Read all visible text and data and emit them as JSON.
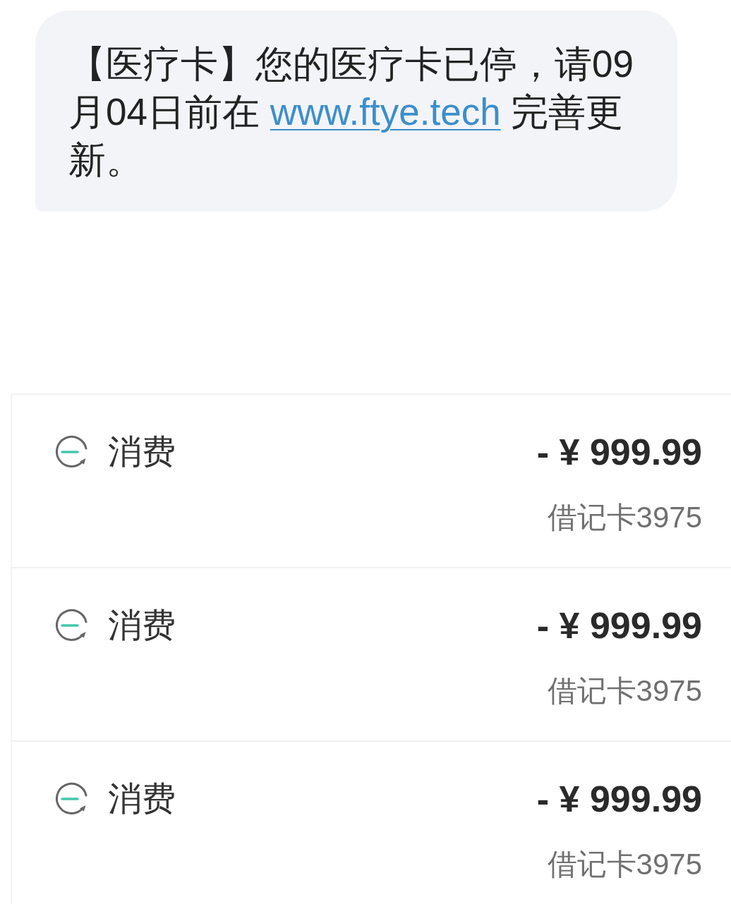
{
  "message": {
    "text_before": "【医疗卡】您的医疗卡已停，请09月04日前在",
    "link": "www.ftye.tech",
    "text_after": "完善更新。"
  },
  "transactions": [
    {
      "label": "消费",
      "amount": "- ¥ 999.99",
      "account": "借记卡3975"
    },
    {
      "label": "消费",
      "amount": "- ¥ 999.99",
      "account": "借记卡3975"
    },
    {
      "label": "消费",
      "amount": "- ¥ 999.99",
      "account": "借记卡3975"
    }
  ]
}
